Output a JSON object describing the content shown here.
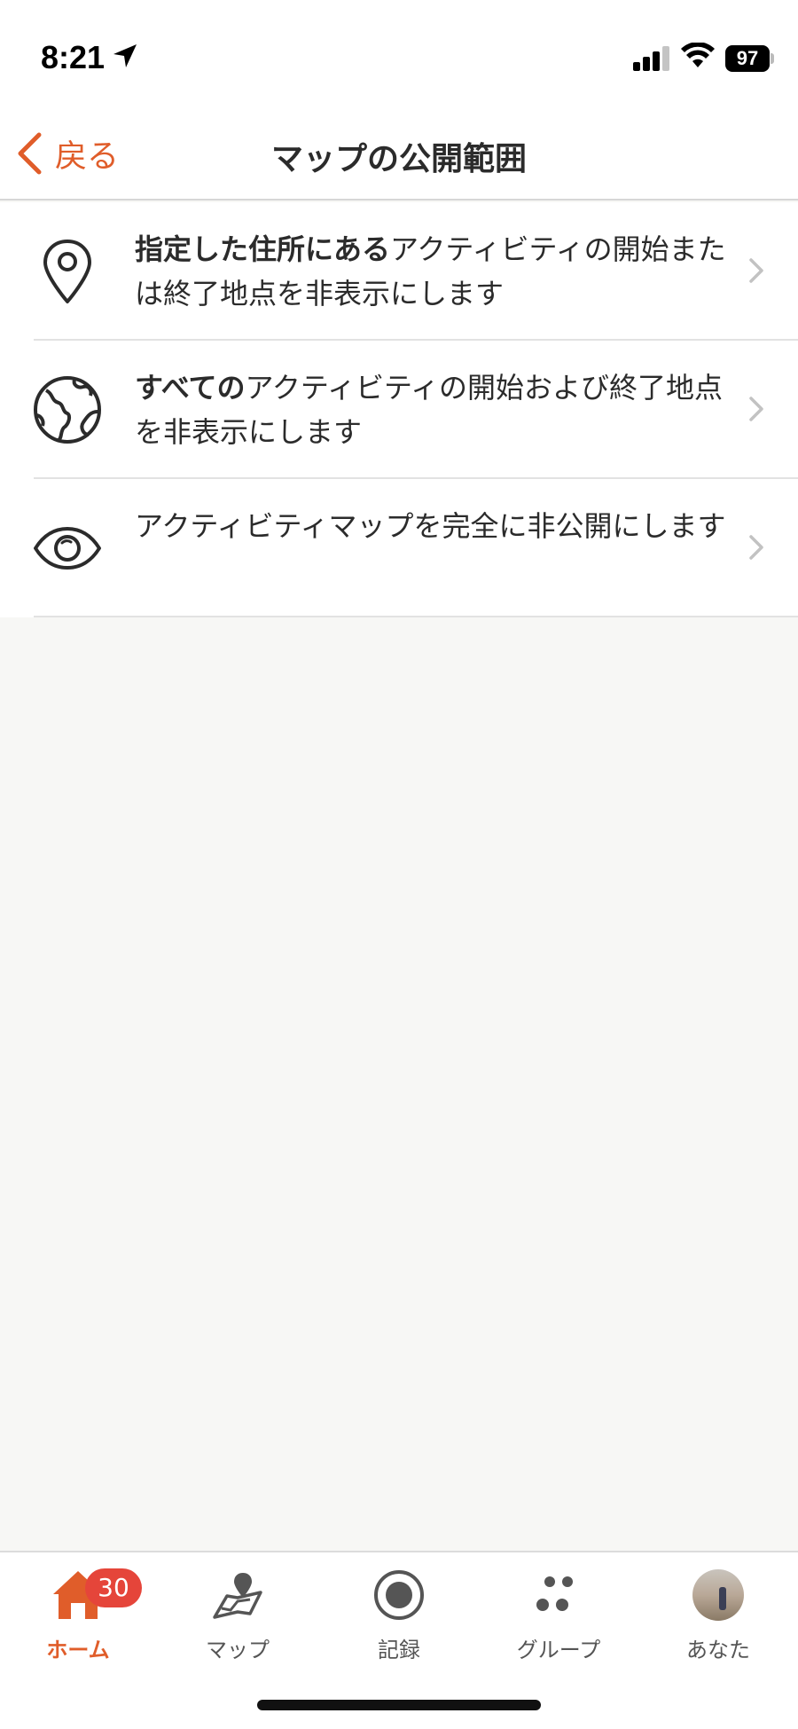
{
  "status_bar": {
    "time": "8:21",
    "battery": "97",
    "icons": [
      "location-arrow-icon",
      "signal-icon",
      "wifi-icon",
      "battery-icon"
    ]
  },
  "nav": {
    "back_label": "戻る",
    "title": "マップの公開範囲",
    "accent_color": "#e05d2a"
  },
  "list": {
    "items": [
      {
        "icon": "location-pin-icon",
        "bold": "指定した住所にある",
        "text": "アクティビティの開始または終了地点を非表示にします"
      },
      {
        "icon": "globe-icon",
        "bold": "すべての",
        "text": "アクティビティの開始および終了地点を非表示にします"
      },
      {
        "icon": "eye-icon",
        "bold": "",
        "text": "アクティビティマップを完全に非公開にします"
      }
    ]
  },
  "tab_bar": {
    "tabs": [
      {
        "label": "ホーム",
        "icon": "home-icon",
        "active": true,
        "badge": "30"
      },
      {
        "label": "マップ",
        "icon": "map-icon",
        "active": false
      },
      {
        "label": "記録",
        "icon": "record-icon",
        "active": false
      },
      {
        "label": "グループ",
        "icon": "groups-icon",
        "active": false
      },
      {
        "label": "あなた",
        "icon": "avatar",
        "active": false
      }
    ],
    "badge_color": "#e5453a"
  }
}
